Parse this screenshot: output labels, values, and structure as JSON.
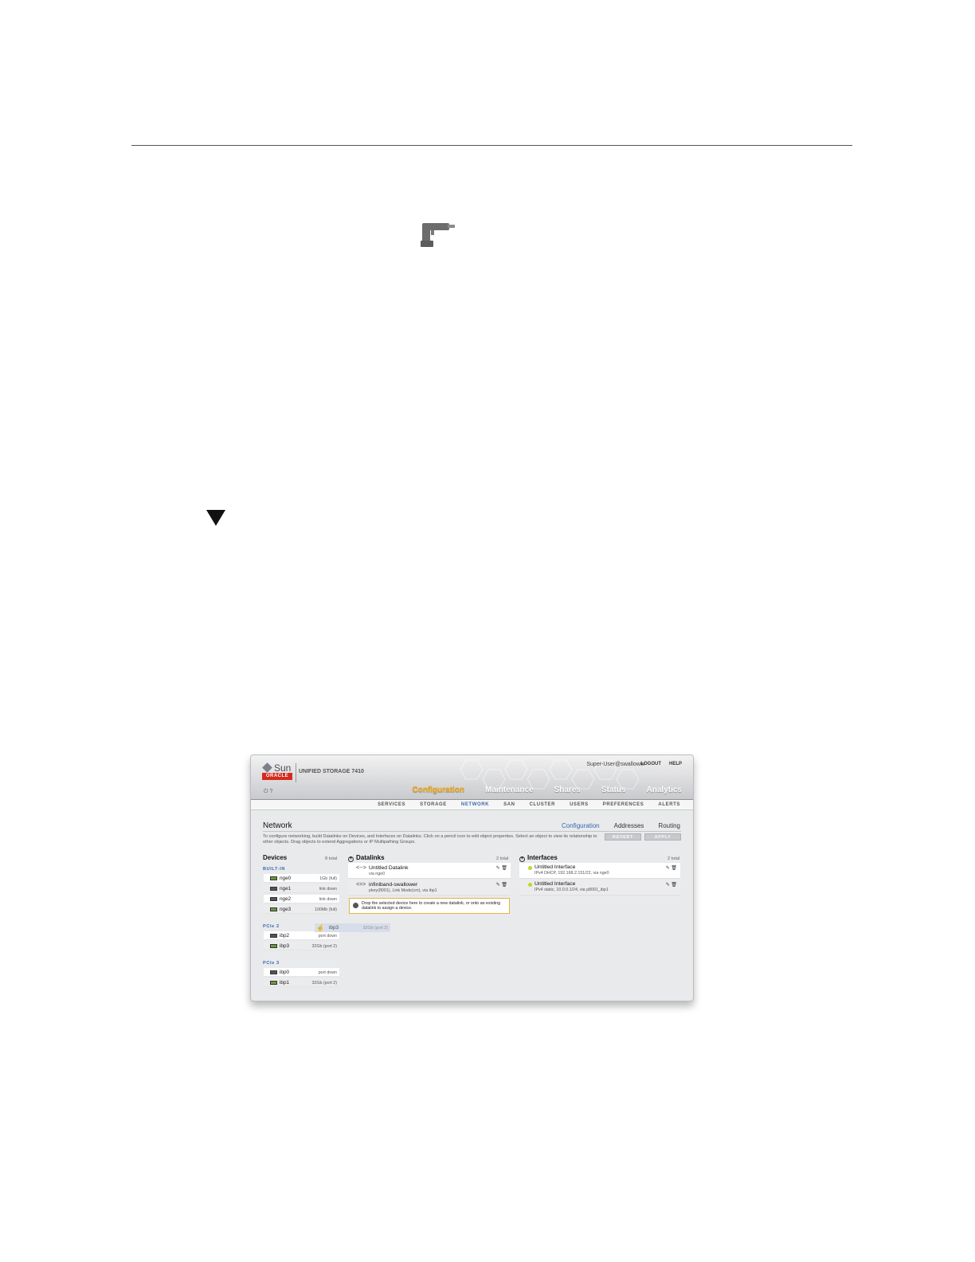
{
  "app": {
    "brand": "Sun",
    "brand_sub": "ORACLE",
    "product": "UNIFIED STORAGE 7410",
    "user": "Super-User@swallower",
    "logout": "LOGOUT",
    "help": "HELP",
    "icons": "⏻ ?"
  },
  "main_tabs": [
    {
      "label": "Configuration",
      "active": true
    },
    {
      "label": "Maintenance",
      "active": false
    },
    {
      "label": "Shares",
      "active": false
    },
    {
      "label": "Status",
      "active": false
    },
    {
      "label": "Analytics",
      "active": false
    }
  ],
  "sub_tabs": [
    {
      "label": "SERVICES",
      "active": false
    },
    {
      "label": "STORAGE",
      "active": false
    },
    {
      "label": "NETWORK",
      "active": true
    },
    {
      "label": "SAN",
      "active": false
    },
    {
      "label": "CLUSTER",
      "active": false
    },
    {
      "label": "USERS",
      "active": false
    },
    {
      "label": "PREFERENCES",
      "active": false
    },
    {
      "label": "ALERTS",
      "active": false
    }
  ],
  "page": {
    "title": "Network",
    "tabs": [
      {
        "label": "Configuration",
        "active": true
      },
      {
        "label": "Addresses",
        "active": false
      },
      {
        "label": "Routing",
        "active": false
      }
    ],
    "description": "To configure networking, build Datalinks on Devices, and Interfaces on Datalinks. Click on a pencil icon to edit object properties. Select an object to view its relationship to other objects. Drag objects to extend Aggregations or IP Multipathing Groups.",
    "revert_label": "REVERT",
    "apply_label": "APPLY"
  },
  "devices": {
    "title": "Devices",
    "count": "8 total",
    "groups": [
      {
        "label": "BUILT-IN",
        "items": [
          {
            "name": "nge0",
            "status": "1Gb (full)",
            "active": true
          },
          {
            "name": "nge1",
            "status": "link down",
            "active": false
          },
          {
            "name": "nge2",
            "status": "link down",
            "active": false
          },
          {
            "name": "nge3",
            "status": "100Mb (full)",
            "active": true
          }
        ]
      },
      {
        "label": "PCIe 2",
        "items": [
          {
            "name": "ibp2",
            "status": "port down",
            "active": false
          },
          {
            "name": "ibp3",
            "status": "32Gb (port 2)",
            "active": true
          }
        ]
      },
      {
        "label": "PCIe 3",
        "items": [
          {
            "name": "ibp0",
            "status": "port down",
            "active": false
          },
          {
            "name": "ibp1",
            "status": "32Gb (port 2)",
            "active": true
          }
        ]
      }
    ],
    "dragging": {
      "name": "ibp3",
      "status": "32Gb (port 2)"
    }
  },
  "datalinks": {
    "title": "Datalinks",
    "count": "2 total",
    "items": [
      {
        "icon": "<-->",
        "name": "Untitled Datalink",
        "sub": "via nge0"
      },
      {
        "icon": "<=>",
        "name": "infiniband-swallower",
        "sub": "pkey(8001), Link Mode(cm), via ibp1"
      }
    ],
    "drop_hint": "Drop the selected device here to create a new datalink, or onto an existing datalink to assign a device."
  },
  "interfaces": {
    "title": "Interfaces",
    "count": "2 total",
    "items": [
      {
        "name": "Untitled Interface",
        "sub": "IPv4 DHCP, 192.168.2.151/22, via nge0"
      },
      {
        "name": "Untitled Interface",
        "sub": "IPv4 static, 10.0.0.1/24, via p8001_ibp1"
      }
    ]
  },
  "tools": "✎ 🗑"
}
